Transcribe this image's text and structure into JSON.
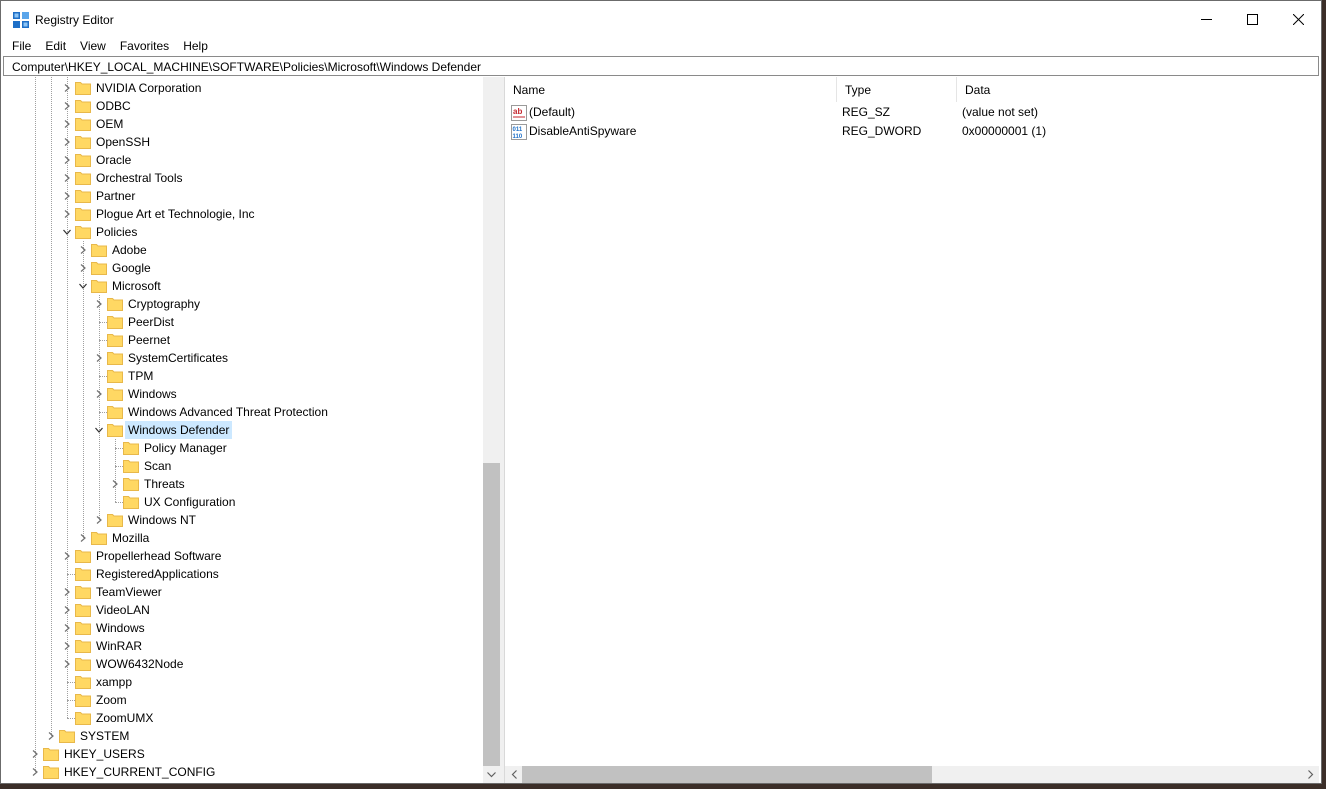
{
  "window": {
    "title": "Registry Editor"
  },
  "menu": [
    "File",
    "Edit",
    "View",
    "Favorites",
    "Help"
  ],
  "address": "Computer\\HKEY_LOCAL_MACHINE\\SOFTWARE\\Policies\\Microsoft\\Windows Defender",
  "tree": [
    {
      "label": "NVIDIA Corporation",
      "level": 2,
      "expander": "collapsed"
    },
    {
      "label": "ODBC",
      "level": 2,
      "expander": "collapsed"
    },
    {
      "label": "OEM",
      "level": 2,
      "expander": "collapsed"
    },
    {
      "label": "OpenSSH",
      "level": 2,
      "expander": "collapsed"
    },
    {
      "label": "Oracle",
      "level": 2,
      "expander": "collapsed"
    },
    {
      "label": "Orchestral Tools",
      "level": 2,
      "expander": "collapsed"
    },
    {
      "label": "Partner",
      "level": 2,
      "expander": "collapsed"
    },
    {
      "label": "Plogue Art et Technologie, Inc",
      "level": 2,
      "expander": "collapsed"
    },
    {
      "label": "Policies",
      "level": 2,
      "expander": "expanded"
    },
    {
      "label": "Adobe",
      "level": 3,
      "expander": "collapsed"
    },
    {
      "label": "Google",
      "level": 3,
      "expander": "collapsed"
    },
    {
      "label": "Microsoft",
      "level": 3,
      "expander": "expanded"
    },
    {
      "label": "Cryptography",
      "level": 4,
      "expander": "collapsed"
    },
    {
      "label": "PeerDist",
      "level": 4,
      "expander": "none"
    },
    {
      "label": "Peernet",
      "level": 4,
      "expander": "none"
    },
    {
      "label": "SystemCertificates",
      "level": 4,
      "expander": "collapsed"
    },
    {
      "label": "TPM",
      "level": 4,
      "expander": "none"
    },
    {
      "label": "Windows",
      "level": 4,
      "expander": "collapsed"
    },
    {
      "label": "Windows Advanced Threat Protection",
      "level": 4,
      "expander": "none"
    },
    {
      "label": "Windows Defender",
      "level": 4,
      "expander": "expanded",
      "selected": true
    },
    {
      "label": "Policy Manager",
      "level": 5,
      "expander": "none"
    },
    {
      "label": "Scan",
      "level": 5,
      "expander": "none"
    },
    {
      "label": "Threats",
      "level": 5,
      "expander": "collapsed"
    },
    {
      "label": "UX Configuration",
      "level": 5,
      "expander": "none"
    },
    {
      "label": "Windows NT",
      "level": 4,
      "expander": "collapsed"
    },
    {
      "label": "Mozilla",
      "level": 3,
      "expander": "collapsed"
    },
    {
      "label": "Propellerhead Software",
      "level": 2,
      "expander": "collapsed"
    },
    {
      "label": "RegisteredApplications",
      "level": 2,
      "expander": "none"
    },
    {
      "label": "TeamViewer",
      "level": 2,
      "expander": "collapsed"
    },
    {
      "label": "VideoLAN",
      "level": 2,
      "expander": "collapsed"
    },
    {
      "label": "Windows",
      "level": 2,
      "expander": "collapsed"
    },
    {
      "label": "WinRAR",
      "level": 2,
      "expander": "collapsed"
    },
    {
      "label": "WOW6432Node",
      "level": 2,
      "expander": "collapsed"
    },
    {
      "label": "xampp",
      "level": 2,
      "expander": "none"
    },
    {
      "label": "Zoom",
      "level": 2,
      "expander": "none"
    },
    {
      "label": "ZoomUMX",
      "level": 2,
      "expander": "none"
    },
    {
      "label": "SYSTEM",
      "level": 1,
      "expander": "collapsed"
    },
    {
      "label": "HKEY_USERS",
      "level": 0,
      "expander": "collapsed"
    },
    {
      "label": "HKEY_CURRENT_CONFIG",
      "level": 0,
      "expander": "collapsed"
    }
  ],
  "list": {
    "columns": [
      "Name",
      "Type",
      "Data"
    ],
    "rows": [
      {
        "name": "(Default)",
        "type": "REG_SZ",
        "data": "(value not set)",
        "icon": "string-value-icon"
      },
      {
        "name": "DisableAntiSpyware",
        "type": "REG_DWORD",
        "data": "0x00000001 (1)",
        "icon": "binary-value-icon"
      }
    ]
  },
  "colors": {
    "selection": "#cce8ff",
    "folder": "#ffd863",
    "folder_dark": "#e8b84a",
    "icon_blue": "#1e6fc7",
    "icon_red": "#c4262e"
  }
}
